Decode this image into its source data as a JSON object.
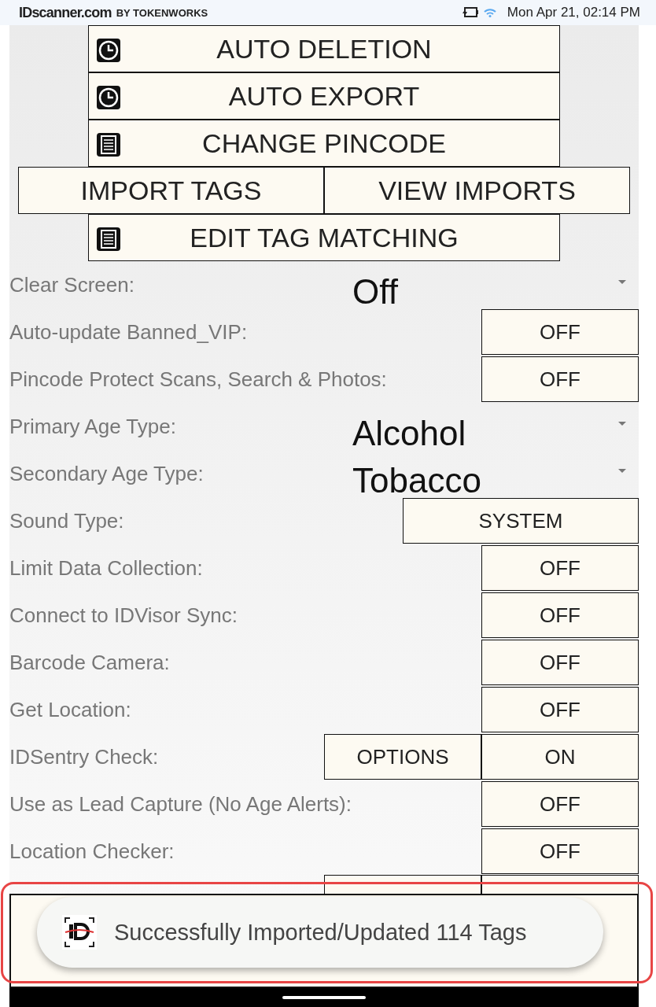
{
  "status_bar": {
    "brand": "IDscanner.com",
    "brand_suffix": "BY TOKENWORKS",
    "datetime": "Mon Apr 21, 02:14 PM"
  },
  "menu_buttons": [
    {
      "label": "AUTO DELETION",
      "kind": "single"
    },
    {
      "label": "AUTO EXPORT",
      "kind": "single"
    },
    {
      "label": "CHANGE PINCODE",
      "kind": "single"
    },
    {
      "kind": "pair",
      "items": [
        {
          "label": "IMPORT TAGS"
        },
        {
          "label": "VIEW IMPORTS"
        }
      ]
    },
    {
      "label": "EDIT TAG MATCHING",
      "kind": "single"
    }
  ],
  "settings": [
    {
      "label": "Clear Screen:",
      "kind": "spinner",
      "value": "Off"
    },
    {
      "label": "Auto-update Banned_VIP:",
      "kind": "toggle",
      "value": "OFF"
    },
    {
      "label": "Pincode Protect Scans, Search & Photos:",
      "kind": "toggle",
      "value": "OFF"
    },
    {
      "label": "Primary Age Type:",
      "kind": "spinner",
      "value": "Alcohol"
    },
    {
      "label": "Secondary Age Type:",
      "kind": "spinner",
      "value": "Tobacco"
    },
    {
      "label": "Sound Type:",
      "kind": "wide",
      "value": "SYSTEM"
    },
    {
      "label": "Limit Data Collection:",
      "kind": "toggle",
      "value": "OFF"
    },
    {
      "label": "Connect to IDVisor Sync:",
      "kind": "toggle",
      "value": "OFF"
    },
    {
      "label": "Barcode Camera:",
      "kind": "toggle",
      "value": "OFF"
    },
    {
      "label": "Get Location:",
      "kind": "toggle",
      "value": "OFF"
    },
    {
      "label": "IDSentry Check:",
      "kind": "options",
      "options": "OPTIONS",
      "value": "ON"
    },
    {
      "label": "Use as Lead Capture (No Age Alerts):",
      "kind": "toggle",
      "value": "OFF"
    },
    {
      "label": "Location Checker:",
      "kind": "toggle",
      "value": "OFF"
    }
  ],
  "toast": {
    "message": "Successfully Imported/Updated 114 Tags"
  }
}
